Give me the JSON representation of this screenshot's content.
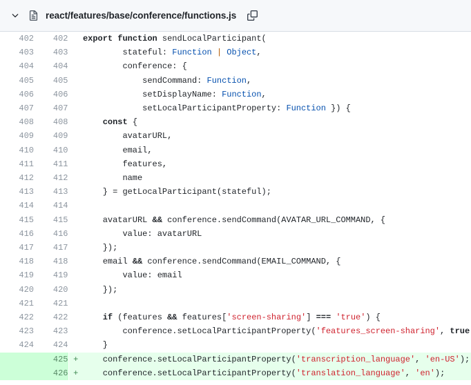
{
  "header": {
    "chevron_icon": "chevron-down-icon",
    "file_icon": "file-icon",
    "file_path": "react/features/base/conference/functions.js",
    "copy_icon": "copy-icon"
  },
  "diff": {
    "rows": [
      {
        "old": "402",
        "new": "402",
        "marker": "",
        "type": "context",
        "tokens": [
          {
            "t": "export",
            "c": "k"
          },
          {
            "t": " ",
            "c": "pl"
          },
          {
            "t": "function",
            "c": "k"
          },
          {
            "t": " sendLocalParticipant(",
            "c": "pl"
          }
        ],
        "text": "export function sendLocalParticipant("
      },
      {
        "old": "403",
        "new": "403",
        "marker": "",
        "type": "context",
        "tokens": [
          {
            "t": "        stateful: ",
            "c": "pl"
          },
          {
            "t": "Function",
            "c": "t"
          },
          {
            "t": " ",
            "c": "pl"
          },
          {
            "t": "|",
            "c": "br"
          },
          {
            "t": " ",
            "c": "pl"
          },
          {
            "t": "Object",
            "c": "t"
          },
          {
            "t": ",",
            "c": "pl"
          }
        ],
        "text": "        stateful: Function | Object,"
      },
      {
        "old": "404",
        "new": "404",
        "marker": "",
        "type": "context",
        "tokens": [
          {
            "t": "        conference: {",
            "c": "pl"
          }
        ],
        "text": "        conference: {"
      },
      {
        "old": "405",
        "new": "405",
        "marker": "",
        "type": "context",
        "tokens": [
          {
            "t": "            sendCommand: ",
            "c": "pl"
          },
          {
            "t": "Function",
            "c": "t"
          },
          {
            "t": ",",
            "c": "pl"
          }
        ],
        "text": "            sendCommand: Function,"
      },
      {
        "old": "406",
        "new": "406",
        "marker": "",
        "type": "context",
        "tokens": [
          {
            "t": "            setDisplayName: ",
            "c": "pl"
          },
          {
            "t": "Function",
            "c": "t"
          },
          {
            "t": ",",
            "c": "pl"
          }
        ],
        "text": "            setDisplayName: Function,"
      },
      {
        "old": "407",
        "new": "407",
        "marker": "",
        "type": "context",
        "tokens": [
          {
            "t": "            setLocalParticipantProperty: ",
            "c": "pl"
          },
          {
            "t": "Function",
            "c": "t"
          },
          {
            "t": " }) {",
            "c": "pl"
          }
        ],
        "text": "            setLocalParticipantProperty: Function }) {"
      },
      {
        "old": "408",
        "new": "408",
        "marker": "",
        "type": "context",
        "tokens": [
          {
            "t": "    ",
            "c": "pl"
          },
          {
            "t": "const",
            "c": "k"
          },
          {
            "t": " {",
            "c": "pl"
          }
        ],
        "text": "    const {"
      },
      {
        "old": "409",
        "new": "409",
        "marker": "",
        "type": "context",
        "tokens": [
          {
            "t": "        avatarURL,",
            "c": "pl"
          }
        ],
        "text": "        avatarURL,"
      },
      {
        "old": "410",
        "new": "410",
        "marker": "",
        "type": "context",
        "tokens": [
          {
            "t": "        email,",
            "c": "pl"
          }
        ],
        "text": "        email,"
      },
      {
        "old": "411",
        "new": "411",
        "marker": "",
        "type": "context",
        "tokens": [
          {
            "t": "        features,",
            "c": "pl"
          }
        ],
        "text": "        features,"
      },
      {
        "old": "412",
        "new": "412",
        "marker": "",
        "type": "context",
        "tokens": [
          {
            "t": "        name",
            "c": "pl"
          }
        ],
        "text": "        name"
      },
      {
        "old": "413",
        "new": "413",
        "marker": "",
        "type": "context",
        "tokens": [
          {
            "t": "    } = getLocalParticipant(stateful);",
            "c": "pl"
          }
        ],
        "text": "    } = getLocalParticipant(stateful);"
      },
      {
        "old": "414",
        "new": "414",
        "marker": "",
        "type": "context",
        "tokens": [
          {
            "t": "",
            "c": "pl"
          }
        ],
        "text": ""
      },
      {
        "old": "415",
        "new": "415",
        "marker": "",
        "type": "context",
        "tokens": [
          {
            "t": "    avatarURL ",
            "c": "pl"
          },
          {
            "t": "&&",
            "c": "op"
          },
          {
            "t": " conference.sendCommand(AVATAR_URL_COMMAND, {",
            "c": "pl"
          }
        ],
        "text": "    avatarURL && conference.sendCommand(AVATAR_URL_COMMAND, {"
      },
      {
        "old": "416",
        "new": "416",
        "marker": "",
        "type": "context",
        "tokens": [
          {
            "t": "        value: avatarURL",
            "c": "pl"
          }
        ],
        "text": "        value: avatarURL"
      },
      {
        "old": "417",
        "new": "417",
        "marker": "",
        "type": "context",
        "tokens": [
          {
            "t": "    });",
            "c": "pl"
          }
        ],
        "text": "    });"
      },
      {
        "old": "418",
        "new": "418",
        "marker": "",
        "type": "context",
        "tokens": [
          {
            "t": "    email ",
            "c": "pl"
          },
          {
            "t": "&&",
            "c": "op"
          },
          {
            "t": " conference.sendCommand(EMAIL_COMMAND, {",
            "c": "pl"
          }
        ],
        "text": "    email && conference.sendCommand(EMAIL_COMMAND, {"
      },
      {
        "old": "419",
        "new": "419",
        "marker": "",
        "type": "context",
        "tokens": [
          {
            "t": "        value: email",
            "c": "pl"
          }
        ],
        "text": "        value: email"
      },
      {
        "old": "420",
        "new": "420",
        "marker": "",
        "type": "context",
        "tokens": [
          {
            "t": "    });",
            "c": "pl"
          }
        ],
        "text": "    });"
      },
      {
        "old": "421",
        "new": "421",
        "marker": "",
        "type": "context",
        "tokens": [
          {
            "t": "",
            "c": "pl"
          }
        ],
        "text": ""
      },
      {
        "old": "422",
        "new": "422",
        "marker": "",
        "type": "context",
        "tokens": [
          {
            "t": "    ",
            "c": "pl"
          },
          {
            "t": "if",
            "c": "k"
          },
          {
            "t": " (features ",
            "c": "pl"
          },
          {
            "t": "&&",
            "c": "op"
          },
          {
            "t": " features[",
            "c": "pl"
          },
          {
            "t": "'screen-sharing'",
            "c": "s"
          },
          {
            "t": "] ",
            "c": "pl"
          },
          {
            "t": "===",
            "c": "op"
          },
          {
            "t": " ",
            "c": "pl"
          },
          {
            "t": "'true'",
            "c": "s"
          },
          {
            "t": ") {",
            "c": "pl"
          }
        ],
        "text": "    if (features && features['screen-sharing'] === 'true') {"
      },
      {
        "old": "423",
        "new": "423",
        "marker": "",
        "type": "context",
        "tokens": [
          {
            "t": "        conference.setLocalParticipantProperty(",
            "c": "pl"
          },
          {
            "t": "'features_screen-sharing'",
            "c": "s"
          },
          {
            "t": ", ",
            "c": "pl"
          },
          {
            "t": "true",
            "c": "bool"
          },
          {
            "t": ");",
            "c": "pl"
          }
        ],
        "text": "        conference.setLocalParticipantProperty('features_screen-sharing', true);"
      },
      {
        "old": "424",
        "new": "424",
        "marker": "",
        "type": "context",
        "tokens": [
          {
            "t": "    }",
            "c": "pl"
          }
        ],
        "text": "    }"
      },
      {
        "old": "",
        "new": "425",
        "marker": "+",
        "type": "add",
        "tokens": [
          {
            "t": "    conference.setLocalParticipantProperty(",
            "c": "pl"
          },
          {
            "t": "'transcription_language'",
            "c": "s"
          },
          {
            "t": ", ",
            "c": "pl"
          },
          {
            "t": "'en-US'",
            "c": "s"
          },
          {
            "t": ");",
            "c": "pl"
          }
        ],
        "text": "    conference.setLocalParticipantProperty('transcription_language', 'en-US');"
      },
      {
        "old": "",
        "new": "426",
        "marker": "+",
        "type": "add",
        "tokens": [
          {
            "t": "    conference.setLocalParticipantProperty(",
            "c": "pl"
          },
          {
            "t": "'translation_language'",
            "c": "s"
          },
          {
            "t": ", ",
            "c": "pl"
          },
          {
            "t": "'en'",
            "c": "s"
          },
          {
            "t": ");",
            "c": "pl"
          }
        ],
        "text": "    conference.setLocalParticipantProperty('translation_language', 'en');"
      }
    ]
  },
  "colors": {
    "header_bg": "#f6f8fa",
    "added_bg": "#e6ffec",
    "added_gutter_bg": "#ccffd8",
    "string": "#cf222e",
    "type": "#0550ae",
    "text": "#1f2328",
    "line_number": "#8c959f"
  }
}
